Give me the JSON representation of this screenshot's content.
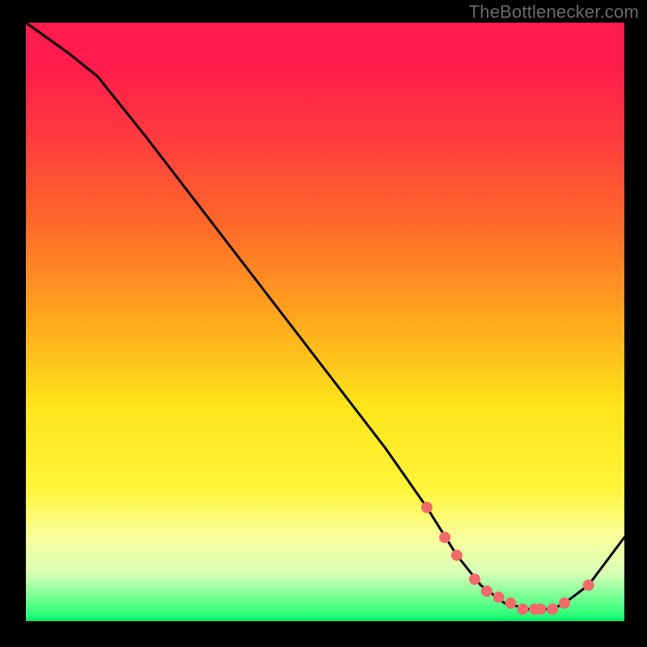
{
  "watermark": "TheBottlenecker.com",
  "chart_data": {
    "type": "line",
    "title": "",
    "xlabel": "",
    "ylabel": "",
    "xlim": [
      0,
      100
    ],
    "ylim": [
      0,
      100
    ],
    "series": [
      {
        "name": "bottleneck-curve",
        "x": [
          0,
          7,
          12,
          20,
          30,
          40,
          50,
          60,
          67,
          72,
          76,
          80,
          84,
          88,
          90,
          94,
          97,
          100
        ],
        "y": [
          100,
          95,
          91,
          81,
          68,
          55,
          42,
          29,
          19,
          11,
          6,
          3,
          2,
          2,
          3,
          6,
          10,
          14
        ]
      }
    ],
    "markers": {
      "color": "#f26a6a",
      "points_x": [
        67,
        70,
        72,
        75,
        77,
        79,
        81,
        83,
        85,
        86,
        88,
        90,
        94
      ],
      "points_y": [
        19,
        14,
        11,
        7,
        5,
        4,
        3,
        2,
        2,
        2,
        2,
        3,
        6
      ]
    },
    "background_gradient": {
      "top": "#ff1b4b",
      "mid": "#ffe41a",
      "bottom": "#00e86a"
    }
  }
}
